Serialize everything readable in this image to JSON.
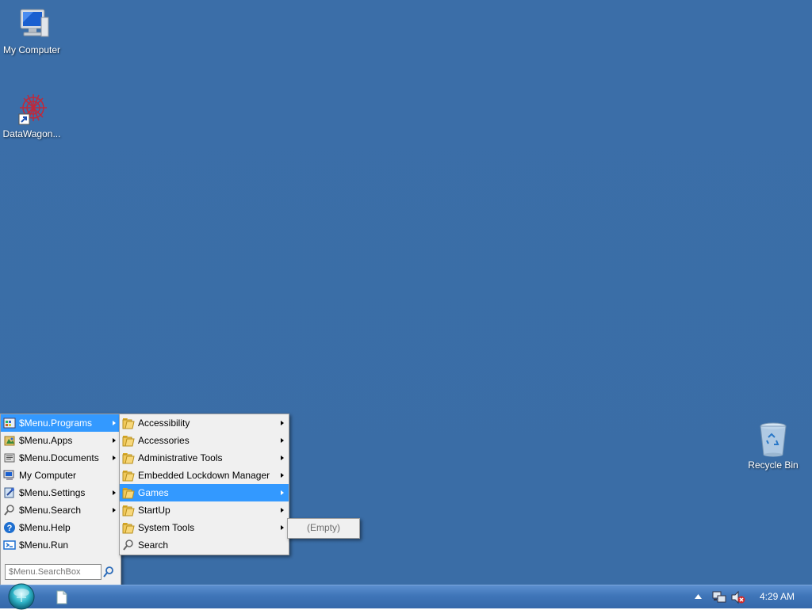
{
  "desktop": {
    "background": "#3a6ea5",
    "icons": [
      {
        "label": "My Computer",
        "icon": "computer-icon"
      },
      {
        "label": "DataWagon...",
        "icon": "datawagon-shortcut-icon"
      },
      {
        "label": "Recycle Bin",
        "icon": "recycle-bin-icon"
      }
    ]
  },
  "start_menu": {
    "items": [
      {
        "label": "$Menu.Programs",
        "icon": "programs-icon",
        "submenu": true,
        "highlighted": true
      },
      {
        "label": "$Menu.Apps",
        "icon": "apps-icon",
        "submenu": true
      },
      {
        "label": "$Menu.Documents",
        "icon": "documents-icon",
        "submenu": true
      },
      {
        "label": "My Computer",
        "icon": "computer-icon",
        "submenu": false
      },
      {
        "label": "$Menu.Settings",
        "icon": "settings-icon",
        "submenu": true
      },
      {
        "label": "$Menu.Search",
        "icon": "search-icon",
        "submenu": true
      },
      {
        "label": "$Menu.Help",
        "icon": "help-icon",
        "submenu": false
      },
      {
        "label": "$Menu.Run",
        "icon": "run-icon",
        "submenu": false
      }
    ],
    "search_placeholder": "$Menu.SearchBox"
  },
  "programs_menu": {
    "items": [
      {
        "label": "Accessibility",
        "icon": "folder-icon",
        "submenu": true
      },
      {
        "label": "Accessories",
        "icon": "folder-icon",
        "submenu": true
      },
      {
        "label": "Administrative Tools",
        "icon": "folder-icon",
        "submenu": true
      },
      {
        "label": "Embedded Lockdown Manager",
        "icon": "folder-icon",
        "submenu": true
      },
      {
        "label": "Games",
        "icon": "folder-icon",
        "submenu": true,
        "highlighted": true
      },
      {
        "label": "StartUp",
        "icon": "folder-icon",
        "submenu": true
      },
      {
        "label": "System Tools",
        "icon": "folder-icon",
        "submenu": true
      },
      {
        "label": "Search",
        "icon": "search-icon",
        "submenu": false
      }
    ]
  },
  "games_menu": {
    "empty_label": "(Empty)"
  },
  "taskbar": {
    "clock": "4:29 AM",
    "accent": "#3568aa",
    "highlight": "#3399ff"
  }
}
